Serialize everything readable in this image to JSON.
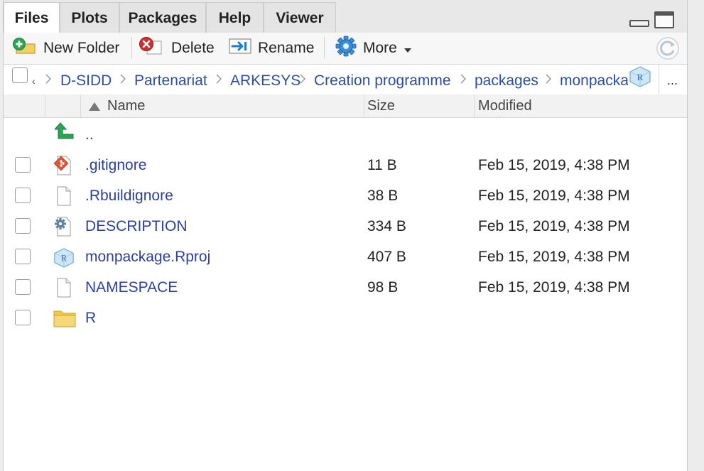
{
  "tabs": [
    "Files",
    "Plots",
    "Packages",
    "Help",
    "Viewer"
  ],
  "toolbar": {
    "new_folder": "New Folder",
    "delete": "Delete",
    "rename": "Rename",
    "more": "More",
    "icons": {
      "new_folder": "add-folder-icon",
      "delete": "delete-icon",
      "rename": "rename-icon",
      "more": "gear-icon",
      "refresh": "refresh-icon"
    }
  },
  "breadcrumb": {
    "home_fragment": "‹",
    "items": [
      "D-SIDD",
      "Partenariat",
      "ARKESYS",
      "Creation programme",
      "packages",
      "monpackage"
    ],
    "overflow": "..."
  },
  "columns": {
    "name": "Name",
    "size": "Size",
    "modified": "Modified"
  },
  "parent_label": "..",
  "files": [
    {
      "name": ".gitignore",
      "size": "11 B",
      "modified": "Feb 15, 2019, 4:38 PM",
      "icon": "git-file-icon"
    },
    {
      "name": ".Rbuildignore",
      "size": "38 B",
      "modified": "Feb 15, 2019, 4:38 PM",
      "icon": "blank-file-icon"
    },
    {
      "name": "DESCRIPTION",
      "size": "334 B",
      "modified": "Feb 15, 2019, 4:38 PM",
      "icon": "settings-file-icon"
    },
    {
      "name": "monpackage.Rproj",
      "size": "407 B",
      "modified": "Feb 15, 2019, 4:38 PM",
      "icon": "rproj-icon"
    },
    {
      "name": "NAMESPACE",
      "size": "98 B",
      "modified": "Feb 15, 2019, 4:38 PM",
      "icon": "blank-file-icon"
    },
    {
      "name": "R",
      "size": "",
      "modified": "",
      "icon": "folder-icon"
    }
  ],
  "colors": {
    "link": "#2a3fa0",
    "crumb": "#2a4ea8",
    "accent_green": "#2aa652",
    "delete_red": "#d32f2f"
  }
}
